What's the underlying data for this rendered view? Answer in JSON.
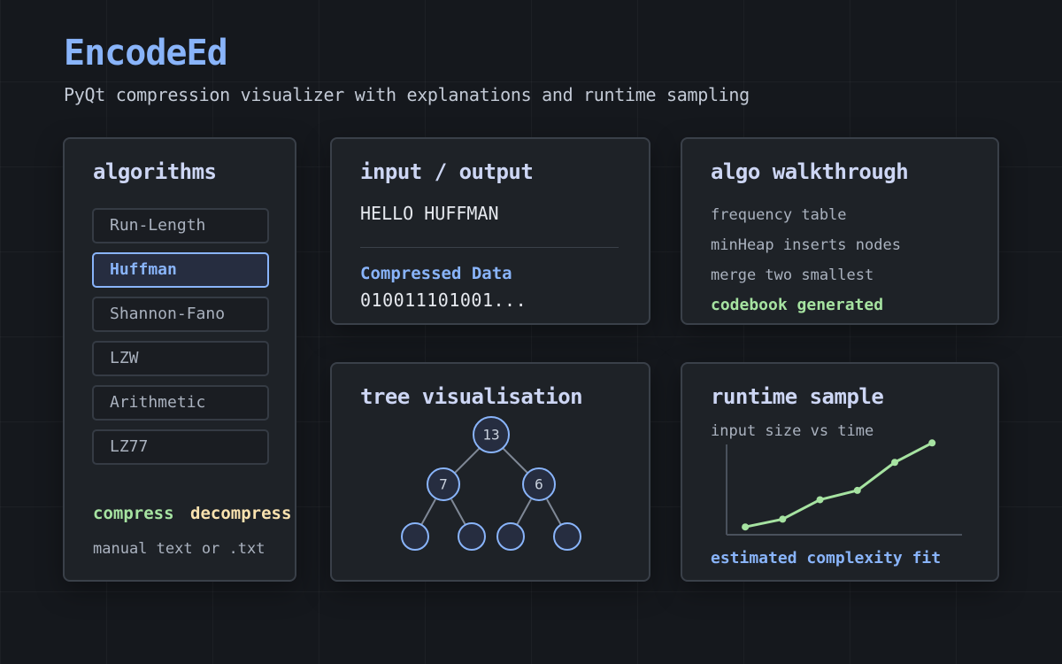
{
  "header": {
    "title": "EncodeEd",
    "subtitle": "PyQt compression visualizer with explanations and runtime sampling"
  },
  "algorithms": {
    "title": "algorithms",
    "items": [
      {
        "label": "Run-Length",
        "selected": false
      },
      {
        "label": "Huffman",
        "selected": true
      },
      {
        "label": "Shannon-Fano",
        "selected": false
      },
      {
        "label": "LZW",
        "selected": false
      },
      {
        "label": "Arithmetic",
        "selected": false
      },
      {
        "label": "LZ77",
        "selected": false
      }
    ],
    "compress_label": "compress",
    "decompress_label": "decompress",
    "input_hint": "manual text or .txt"
  },
  "io": {
    "title": "input / output",
    "input_text": "HELLO HUFFMAN",
    "output_label": "Compressed Data",
    "output_value": "010011101001..."
  },
  "walkthrough": {
    "title": "algo walkthrough",
    "steps": [
      "frequency table",
      "minHeap inserts nodes",
      "merge two smallest"
    ],
    "final_step": "codebook generated"
  },
  "tree": {
    "title": "tree visualisation",
    "root": {
      "value": "13"
    },
    "children": [
      {
        "value": "7"
      },
      {
        "value": "6"
      }
    ],
    "leaves": [
      "",
      "",
      "",
      ""
    ]
  },
  "runtime": {
    "title": "runtime sample",
    "caption": "input size vs time",
    "footer": "estimated complexity fit"
  },
  "chart_data": {
    "type": "line",
    "title": "runtime sample",
    "subtitle": "input size vs time",
    "xlabel": "",
    "ylabel": "",
    "x": [
      1,
      2,
      3,
      4,
      5,
      6
    ],
    "series": [
      {
        "values": [
          1.0,
          2.0,
          4.5,
          5.7,
          9.3,
          11.8
        ]
      }
    ],
    "xlim": [
      0.5,
      6.8
    ],
    "ylim": [
      0,
      12.4
    ],
    "grid": false,
    "colors": {
      "line": "#a6e3a1",
      "axis": "#4a515c"
    }
  },
  "colors": {
    "accent": "#89b4fa",
    "success": "#a6e3a1",
    "warning": "#f9e2af"
  }
}
